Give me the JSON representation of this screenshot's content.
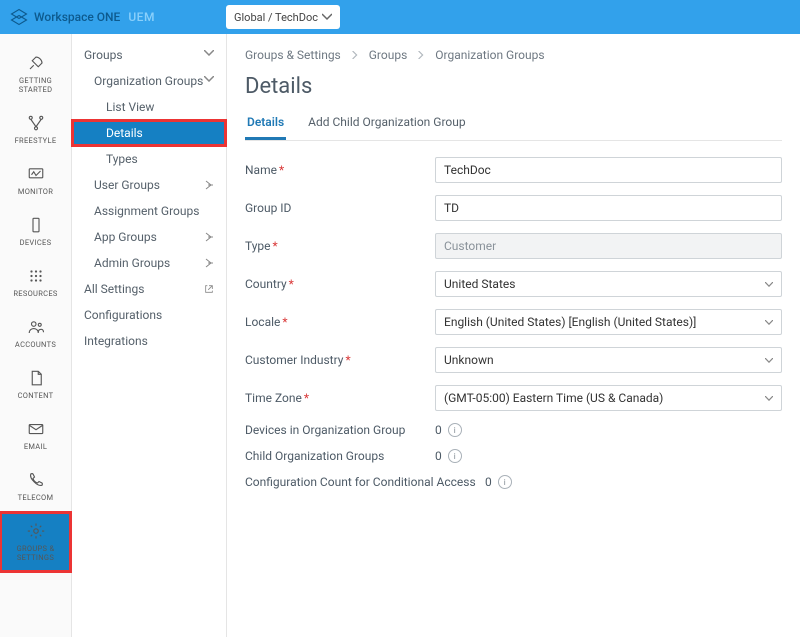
{
  "brand": {
    "name": "Workspace ONE",
    "sub": "UEM"
  },
  "org_selector": "Global / TechDoc",
  "leftnav": [
    {
      "key": "getting-started",
      "label": "GETTING STARTED"
    },
    {
      "key": "freestyle",
      "label": "FREESTYLE"
    },
    {
      "key": "monitor",
      "label": "MONITOR"
    },
    {
      "key": "devices",
      "label": "DEVICES"
    },
    {
      "key": "resources",
      "label": "RESOURCES"
    },
    {
      "key": "accounts",
      "label": "ACCOUNTS"
    },
    {
      "key": "content",
      "label": "CONTENT"
    },
    {
      "key": "email",
      "label": "EMAIL"
    },
    {
      "key": "telecom",
      "label": "TELECOM"
    },
    {
      "key": "groups-settings",
      "label": "GROUPS & SETTINGS"
    }
  ],
  "sidepanel": {
    "groups": "Groups",
    "org_groups": "Organization Groups",
    "list_view": "List View",
    "details": "Details",
    "types": "Types",
    "user_groups": "User Groups",
    "assignment_groups": "Assignment Groups",
    "app_groups": "App Groups",
    "admin_groups": "Admin Groups",
    "all_settings": "All Settings",
    "configurations": "Configurations",
    "integrations": "Integrations"
  },
  "breadcrumb": [
    "Groups & Settings",
    "Groups",
    "Organization Groups"
  ],
  "page_title": "Details",
  "tabs": {
    "details": "Details",
    "add_child": "Add Child Organization Group"
  },
  "form": {
    "name_label": "Name",
    "name_value": "TechDoc",
    "group_id_label": "Group ID",
    "group_id_value": "TD",
    "type_label": "Type",
    "type_value": "Customer",
    "country_label": "Country",
    "country_value": "United States",
    "locale_label": "Locale",
    "locale_value": "English (United States) [English (United States)]",
    "industry_label": "Customer Industry",
    "industry_value": "Unknown",
    "timezone_label": "Time Zone",
    "timezone_value": "(GMT-05:00) Eastern Time (US & Canada)",
    "devices_label": "Devices in Organization Group",
    "devices_value": "0",
    "child_label": "Child Organization Groups",
    "child_value": "0",
    "config_label": "Configuration Count for Conditional Access",
    "config_value": "0"
  }
}
